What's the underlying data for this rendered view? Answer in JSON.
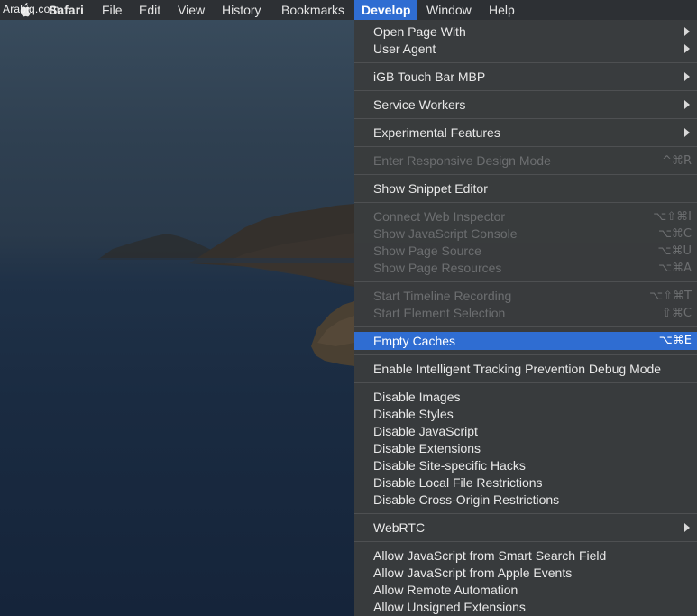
{
  "watermark": "Arabiq.com",
  "menubar": {
    "items": [
      "Safari",
      "File",
      "Edit",
      "View",
      "History",
      "Bookmarks",
      "Develop",
      "Window",
      "Help"
    ]
  },
  "develop_menu": {
    "items": [
      {
        "label": "Open Page With"
      },
      {
        "label": "User Agent"
      },
      {
        "label": "iGB Touch Bar MBP"
      },
      {
        "label": "Service Workers"
      },
      {
        "label": "Experimental Features"
      },
      {
        "label": "Enter Responsive Design Mode",
        "shortcut": "^⌘R"
      },
      {
        "label": "Show Snippet Editor"
      },
      {
        "label": "Connect Web Inspector",
        "shortcut": "⌥⇧⌘I"
      },
      {
        "label": "Show JavaScript Console",
        "shortcut": "⌥⌘C"
      },
      {
        "label": "Show Page Source",
        "shortcut": "⌥⌘U"
      },
      {
        "label": "Show Page Resources",
        "shortcut": "⌥⌘A"
      },
      {
        "label": "Start Timeline Recording",
        "shortcut": "⌥⇧⌘T"
      },
      {
        "label": "Start Element Selection",
        "shortcut": "⇧⌘C"
      },
      {
        "label": "Empty Caches",
        "shortcut": "⌥⌘E"
      },
      {
        "label": "Enable Intelligent Tracking Prevention Debug Mode"
      },
      {
        "label": "Disable Images"
      },
      {
        "label": "Disable Styles"
      },
      {
        "label": "Disable JavaScript"
      },
      {
        "label": "Disable Extensions"
      },
      {
        "label": "Disable Site-specific Hacks"
      },
      {
        "label": "Disable Local File Restrictions"
      },
      {
        "label": "Disable Cross-Origin Restrictions"
      },
      {
        "label": "WebRTC"
      },
      {
        "label": "Allow JavaScript from Smart Search Field"
      },
      {
        "label": "Allow JavaScript from Apple Events"
      },
      {
        "label": "Allow Remote Automation"
      },
      {
        "label": "Allow Unsigned Extensions"
      }
    ]
  },
  "colors": {
    "menubar_bg": "#2d3034",
    "menu_bg": "#3a3c3d",
    "highlight": "#2f6dd2",
    "disabled_text": "#6c6e70"
  },
  "icons": {
    "apple": "apple-icon",
    "submenu": "chevron-right-icon"
  }
}
